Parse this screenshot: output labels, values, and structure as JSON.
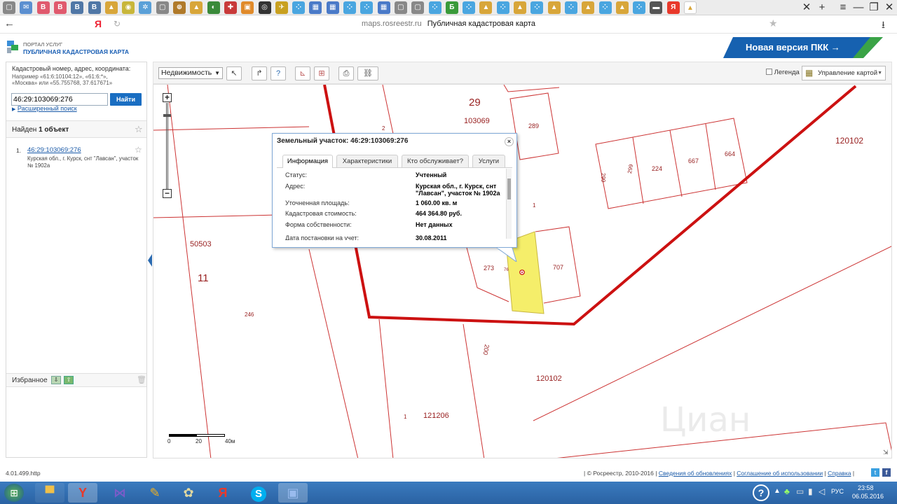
{
  "browser": {
    "url_host": "maps.rosreestr.ru",
    "page_title": "Публичная кадастровая карта",
    "tabs": [
      {
        "icon": "doc-icon",
        "color": "#888888",
        "glyph": "▢"
      },
      {
        "icon": "mail-icon",
        "color": "#5b8fd0",
        "glyph": "✉"
      },
      {
        "icon": "b-icon",
        "color": "#e05a6e",
        "glyph": "B"
      },
      {
        "icon": "b-icon",
        "color": "#e05a6e",
        "glyph": "B"
      },
      {
        "icon": "vk-icon",
        "color": "#5077a6",
        "glyph": "В"
      },
      {
        "icon": "vk-icon",
        "color": "#5077a6",
        "glyph": "В"
      },
      {
        "icon": "photo-icon",
        "color": "#d8a63a",
        "glyph": "▲"
      },
      {
        "icon": "yellow-icon",
        "color": "#c8b63a",
        "glyph": "◉"
      },
      {
        "icon": "star-icon",
        "color": "#5aa0d8",
        "glyph": "✲"
      },
      {
        "icon": "doc-icon",
        "color": "#888888",
        "glyph": "▢"
      },
      {
        "icon": "target-icon",
        "color": "#b07a2a",
        "glyph": "⊕"
      },
      {
        "icon": "photo-icon",
        "color": "#d8a63a",
        "glyph": "▲"
      },
      {
        "icon": "green-icon",
        "color": "#3a8a3a",
        "glyph": "◐"
      },
      {
        "icon": "red-icon",
        "color": "#c83a3a",
        "glyph": "✚"
      },
      {
        "icon": "orange-icon",
        "color": "#e08a2a",
        "glyph": "▣"
      },
      {
        "icon": "circle-icon",
        "color": "#333333",
        "glyph": "◎"
      },
      {
        "icon": "yellow-icon",
        "color": "#c8a020",
        "glyph": "✈"
      },
      {
        "icon": "dots-icon",
        "color": "#4aa6e0",
        "glyph": "⁘"
      },
      {
        "icon": "grid-icon",
        "color": "#4a7ac8",
        "glyph": "▦"
      },
      {
        "icon": "grid-icon",
        "color": "#4a7ac8",
        "glyph": "▦"
      },
      {
        "icon": "dots-icon",
        "color": "#4aa6e0",
        "glyph": "⁘"
      },
      {
        "icon": "dots-icon",
        "color": "#4aa6e0",
        "glyph": "⁘"
      },
      {
        "icon": "grid-icon",
        "color": "#4a7ac8",
        "glyph": "▦"
      },
      {
        "icon": "doc-icon",
        "color": "#888888",
        "glyph": "▢"
      },
      {
        "icon": "doc-icon",
        "color": "#888888",
        "glyph": "▢"
      },
      {
        "icon": "dots-icon",
        "color": "#4aa6e0",
        "glyph": "⁘"
      },
      {
        "icon": "b-green-icon",
        "color": "#3a9a3a",
        "glyph": "Б"
      },
      {
        "icon": "dots-icon",
        "color": "#4aa6e0",
        "glyph": "⁘"
      },
      {
        "icon": "photo-icon",
        "color": "#d8a63a",
        "glyph": "▲"
      },
      {
        "icon": "dots-icon",
        "color": "#4aa6e0",
        "glyph": "⁘"
      },
      {
        "icon": "photo-icon",
        "color": "#d8a63a",
        "glyph": "▲"
      },
      {
        "icon": "dots-icon",
        "color": "#4aa6e0",
        "glyph": "⁘"
      },
      {
        "icon": "photo-icon",
        "color": "#d8a63a",
        "glyph": "▲"
      },
      {
        "icon": "dots-icon",
        "color": "#4aa6e0",
        "glyph": "⁘"
      },
      {
        "icon": "photo-icon",
        "color": "#d8a63a",
        "glyph": "▲"
      },
      {
        "icon": "dots-icon",
        "color": "#4aa6e0",
        "glyph": "⁘"
      },
      {
        "icon": "photo-icon",
        "color": "#d8a63a",
        "glyph": "▲"
      },
      {
        "icon": "dots-icon",
        "color": "#4aa6e0",
        "glyph": "⁘"
      },
      {
        "icon": "printer-icon",
        "color": "#555555",
        "glyph": "▬"
      },
      {
        "icon": "yandex-icon",
        "color": "#e8392b",
        "glyph": "Я"
      },
      {
        "icon": "photo-icon",
        "color": "#d8a63a",
        "glyph": "▲"
      }
    ]
  },
  "header": {
    "logo_line1": "ПОРТАЛ УСЛУГ",
    "logo_line2": "ПУБЛИЧНАЯ КАДАСТРОВАЯ КАРТА",
    "new_version_label": "Новая версия ПКК →"
  },
  "sidebar": {
    "hint_line1": "Кадастровый номер, адрес, координата:",
    "hint_line2": "Например «61:6:10104:12», «61:6:*»,",
    "hint_line3": "«Москва» или «55.755768, 37.617671»",
    "search_value": "46:29:103069:276",
    "find_button": "Найти",
    "advanced_search": "Расширенный поиск",
    "found_prefix": "Найден",
    "found_count": "1 объект",
    "result_index": "1.",
    "result_link": "46:29:103069:276",
    "result_address": "Курская обл., г. Курск, снт \"Лавсан\", участок № 1902а",
    "favorites_label": "Избранное"
  },
  "toolbar": {
    "layer_select": "Недвижимость",
    "legend_label": "Легенда",
    "map_control_label": "Управление картой"
  },
  "popup": {
    "title": "Земельный участок: 46:29:103069:276",
    "tabs": [
      "Информация",
      "Характеристики",
      "Кто обслуживает?",
      "Услуги"
    ],
    "rows": [
      {
        "k": "Статус:",
        "v": "Учтенный"
      },
      {
        "k": "Адрес:",
        "v": "Курская обл., г. Курск, снт \"Лавсан\", участок № 1902а"
      },
      {
        "k": "Уточненная площадь:",
        "v": "1 060.00 кв. м"
      },
      {
        "k": "Кадастровая стоимость:",
        "v": "464 364.80 руб."
      },
      {
        "k": "Форма собственности:",
        "v": "Нет данных"
      },
      {
        "k": "Дата постановки на учет:",
        "v": "30.08.2011"
      }
    ]
  },
  "map": {
    "labels": [
      "29",
      "103069",
      "2",
      "289",
      "120102",
      "299",
      "299",
      "224",
      "667",
      "664",
      "1",
      "50503",
      "11",
      "246",
      "273",
      "707",
      "120102",
      "121206",
      "1",
      "200",
      "76"
    ],
    "scale": {
      "s0": "0",
      "s1": "20",
      "s2": "40м"
    },
    "colors": {
      "boundary": "#cc1111",
      "parcel": "#cc3333",
      "selected": "#f5ee6a",
      "label": "#992222"
    }
  },
  "footer": {
    "version": "4.01.499.http",
    "copyright": "| © Росреестр, 2010-2016 |",
    "updates_link": "Сведения об обновлениях",
    "agreement_link": "Соглашение об использовании",
    "help_link": "Справка"
  },
  "taskbar": {
    "lang": "РУС",
    "time": "23:58",
    "date": "06.05.2016"
  }
}
